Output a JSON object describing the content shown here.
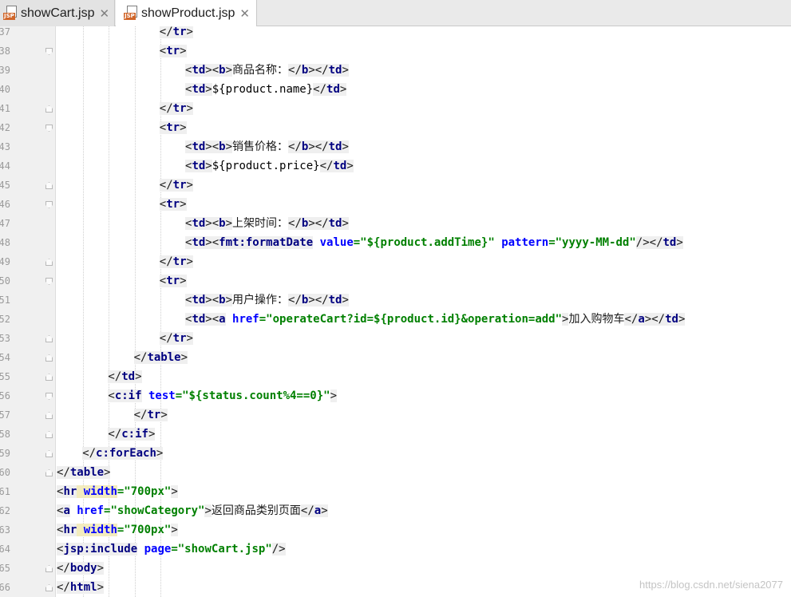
{
  "tabs": [
    {
      "label": "showCart.jsp",
      "icon_text": "JSP",
      "active": false
    },
    {
      "label": "showProduct.jsp",
      "icon_text": "JSP",
      "active": true
    }
  ],
  "editor": {
    "line_number_prefix": "",
    "lines": [
      {
        "no": "37",
        "indent": 4,
        "parts": [
          [
            "pu",
            "</"
          ],
          [
            "tag",
            "tr"
          ],
          [
            "pu",
            ">"
          ]
        ]
      },
      {
        "no": "38",
        "indent": 4,
        "parts": [
          [
            "pu",
            "<"
          ],
          [
            "tag",
            "tr"
          ],
          [
            "pu",
            ">"
          ]
        ]
      },
      {
        "no": "39",
        "indent": 5,
        "parts": [
          [
            "pu",
            "<"
          ],
          [
            "tag",
            "td"
          ],
          [
            "pu",
            "><"
          ],
          [
            "tag",
            "b"
          ],
          [
            "pu",
            ">"
          ],
          [
            "el",
            "商品名称："
          ],
          [
            "pu",
            "</"
          ],
          [
            "tag",
            "b"
          ],
          [
            "pu",
            "></"
          ],
          [
            "tag",
            "td"
          ],
          [
            "pu",
            ">"
          ]
        ]
      },
      {
        "no": "40",
        "indent": 5,
        "parts": [
          [
            "pu",
            "<"
          ],
          [
            "tag",
            "td"
          ],
          [
            "pu",
            ">"
          ],
          [
            "ex",
            "${product.name}"
          ],
          [
            "pu",
            "</"
          ],
          [
            "tag",
            "td"
          ],
          [
            "pu",
            ">"
          ]
        ]
      },
      {
        "no": "41",
        "indent": 4,
        "parts": [
          [
            "pu",
            "</"
          ],
          [
            "tag",
            "tr"
          ],
          [
            "pu",
            ">"
          ]
        ]
      },
      {
        "no": "42",
        "indent": 4,
        "parts": [
          [
            "pu",
            "<"
          ],
          [
            "tag",
            "tr"
          ],
          [
            "pu",
            ">"
          ]
        ]
      },
      {
        "no": "43",
        "indent": 5,
        "parts": [
          [
            "pu",
            "<"
          ],
          [
            "tag",
            "td"
          ],
          [
            "pu",
            "><"
          ],
          [
            "tag",
            "b"
          ],
          [
            "pu",
            ">"
          ],
          [
            "el",
            "销售价格："
          ],
          [
            "pu",
            "</"
          ],
          [
            "tag",
            "b"
          ],
          [
            "pu",
            "></"
          ],
          [
            "tag",
            "td"
          ],
          [
            "pu",
            ">"
          ]
        ]
      },
      {
        "no": "44",
        "indent": 5,
        "parts": [
          [
            "pu",
            "<"
          ],
          [
            "tag",
            "td"
          ],
          [
            "pu",
            ">"
          ],
          [
            "ex",
            "${product.price}"
          ],
          [
            "pu",
            "</"
          ],
          [
            "tag",
            "td"
          ],
          [
            "pu",
            ">"
          ]
        ]
      },
      {
        "no": "45",
        "indent": 4,
        "parts": [
          [
            "pu",
            "</"
          ],
          [
            "tag",
            "tr"
          ],
          [
            "pu",
            ">"
          ]
        ]
      },
      {
        "no": "46",
        "indent": 4,
        "parts": [
          [
            "pu",
            "<"
          ],
          [
            "tag",
            "tr"
          ],
          [
            "pu",
            ">"
          ]
        ]
      },
      {
        "no": "47",
        "indent": 5,
        "parts": [
          [
            "pu",
            "<"
          ],
          [
            "tag",
            "td"
          ],
          [
            "pu",
            "><"
          ],
          [
            "tag",
            "b"
          ],
          [
            "pu",
            ">"
          ],
          [
            "el",
            "上架时间："
          ],
          [
            "pu",
            "</"
          ],
          [
            "tag",
            "b"
          ],
          [
            "pu",
            "></"
          ],
          [
            "tag",
            "td"
          ],
          [
            "pu",
            ">"
          ]
        ]
      },
      {
        "no": "48",
        "indent": 5,
        "parts": [
          [
            "pu",
            "<"
          ],
          [
            "tag",
            "td"
          ],
          [
            "pu",
            "><"
          ],
          [
            "tag",
            "fmt:formatDate"
          ],
          [
            "an",
            " value"
          ],
          [
            "av",
            "=\"${product.addTime}\""
          ],
          [
            "an",
            " pattern"
          ],
          [
            "av",
            "=\"yyyy-MM-dd\""
          ],
          [
            "pu",
            "/></"
          ],
          [
            "tag",
            "td"
          ],
          [
            "pu",
            ">"
          ]
        ]
      },
      {
        "no": "49",
        "indent": 4,
        "parts": [
          [
            "pu",
            "</"
          ],
          [
            "tag",
            "tr"
          ],
          [
            "pu",
            ">"
          ]
        ]
      },
      {
        "no": "50",
        "indent": 4,
        "parts": [
          [
            "pu",
            "<"
          ],
          [
            "tag",
            "tr"
          ],
          [
            "pu",
            ">"
          ]
        ]
      },
      {
        "no": "51",
        "indent": 5,
        "parts": [
          [
            "pu",
            "<"
          ],
          [
            "tag",
            "td"
          ],
          [
            "pu",
            "><"
          ],
          [
            "tag",
            "b"
          ],
          [
            "pu",
            ">"
          ],
          [
            "el",
            "用户操作："
          ],
          [
            "pu",
            "</"
          ],
          [
            "tag",
            "b"
          ],
          [
            "pu",
            "></"
          ],
          [
            "tag",
            "td"
          ],
          [
            "pu",
            ">"
          ]
        ]
      },
      {
        "no": "52",
        "indent": 5,
        "parts": [
          [
            "pu",
            "<"
          ],
          [
            "tag",
            "td"
          ],
          [
            "pu",
            "><"
          ],
          [
            "tag",
            "a"
          ],
          [
            "an",
            " href"
          ],
          [
            "av",
            "=\"operateCart?id=${product.id}&operation=add\""
          ],
          [
            "pu",
            ">"
          ],
          [
            "el",
            "加入购物车"
          ],
          [
            "pu",
            "</"
          ],
          [
            "tag",
            "a"
          ],
          [
            "pu",
            "></"
          ],
          [
            "tag",
            "td"
          ],
          [
            "pu",
            ">"
          ]
        ]
      },
      {
        "no": "53",
        "indent": 4,
        "parts": [
          [
            "pu",
            "</"
          ],
          [
            "tag",
            "tr"
          ],
          [
            "pu",
            ">"
          ]
        ]
      },
      {
        "no": "54",
        "indent": 3,
        "parts": [
          [
            "pu",
            "</"
          ],
          [
            "tag",
            "table"
          ],
          [
            "pu",
            ">"
          ]
        ]
      },
      {
        "no": "55",
        "indent": 2,
        "parts": [
          [
            "pu",
            "</"
          ],
          [
            "tag",
            "td"
          ],
          [
            "pu",
            ">"
          ]
        ]
      },
      {
        "no": "56",
        "indent": 2,
        "parts": [
          [
            "pu",
            "<"
          ],
          [
            "tag",
            "c:if"
          ],
          [
            "an",
            " test"
          ],
          [
            "av",
            "=\"${status.count%4==0}\""
          ],
          [
            "pu",
            ">"
          ]
        ]
      },
      {
        "no": "57",
        "indent": 3,
        "parts": [
          [
            "pu",
            "</"
          ],
          [
            "tag",
            "tr"
          ],
          [
            "pu",
            ">"
          ]
        ]
      },
      {
        "no": "58",
        "indent": 2,
        "parts": [
          [
            "pu",
            "</"
          ],
          [
            "tag",
            "c:if"
          ],
          [
            "pu",
            ">"
          ]
        ]
      },
      {
        "no": "59",
        "indent": 1,
        "parts": [
          [
            "pu",
            "</"
          ],
          [
            "tag",
            "c:forEach"
          ],
          [
            "pu",
            ">"
          ]
        ]
      },
      {
        "no": "60",
        "indent": 0,
        "parts": [
          [
            "pu",
            "</"
          ],
          [
            "tag",
            "table"
          ],
          [
            "pu",
            ">"
          ]
        ]
      },
      {
        "no": "61",
        "indent": 0,
        "parts": [
          [
            "pu",
            "<"
          ],
          [
            "tag",
            "hr"
          ],
          [
            "an",
            " width"
          ],
          [
            "av",
            "=\"700px\""
          ],
          [
            "pu",
            ">"
          ]
        ]
      },
      {
        "no": "62",
        "indent": 0,
        "parts": [
          [
            "pu",
            "<"
          ],
          [
            "tag",
            "a"
          ],
          [
            "an",
            " href"
          ],
          [
            "av",
            "=\"showCategory\""
          ],
          [
            "pu",
            ">"
          ],
          [
            "el",
            "返回商品类别页面"
          ],
          [
            "pu",
            "</"
          ],
          [
            "tag",
            "a"
          ],
          [
            "pu",
            ">"
          ]
        ]
      },
      {
        "no": "63",
        "indent": 0,
        "parts": [
          [
            "pu",
            "<"
          ],
          [
            "tag",
            "hr"
          ],
          [
            "an",
            " width"
          ],
          [
            "av",
            "=\"700px\""
          ],
          [
            "pu",
            ">"
          ]
        ]
      },
      {
        "no": "64",
        "indent": 0,
        "parts": [
          [
            "pu",
            "<"
          ],
          [
            "tag",
            "jsp:include"
          ],
          [
            "an",
            " page"
          ],
          [
            "av",
            "=\"showCart.jsp\""
          ],
          [
            "pu",
            "/>"
          ]
        ]
      },
      {
        "no": "65",
        "indent": 0,
        "parts": [
          [
            "pu",
            "</"
          ],
          [
            "tag",
            "body"
          ],
          [
            "pu",
            ">"
          ]
        ]
      },
      {
        "no": "66",
        "indent": 0,
        "parts": [
          [
            "pu",
            "</"
          ],
          [
            "tag",
            "html"
          ],
          [
            "pu",
            ">"
          ]
        ]
      }
    ]
  },
  "watermark": "https://blog.csdn.net/siena2077"
}
